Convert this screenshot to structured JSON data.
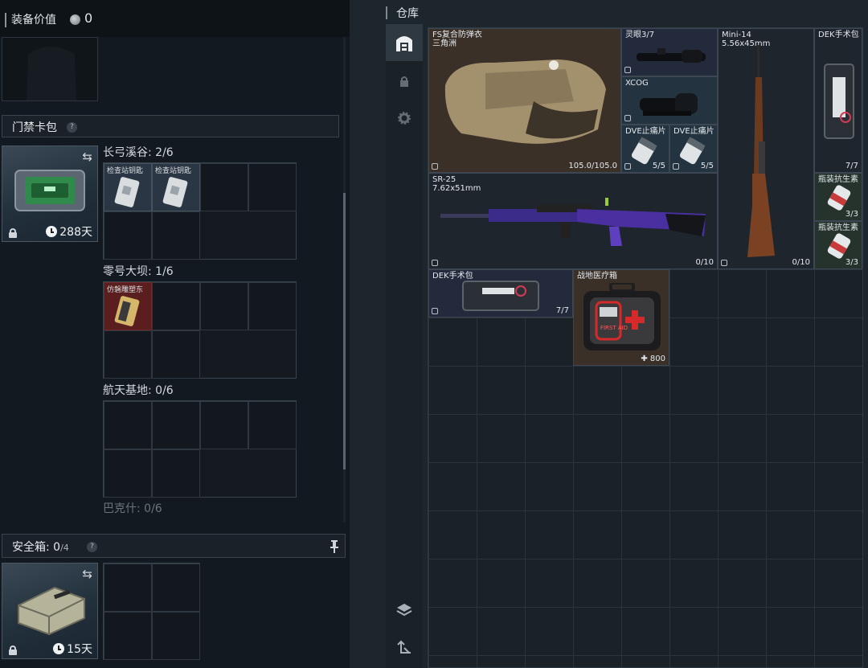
{
  "left": {
    "equipment_value_label": "装备价值",
    "equipment_value": "0",
    "access_card": {
      "title": "门禁卡包",
      "help": "?",
      "timer": "288天",
      "zones": [
        {
          "label": "长弓溪谷: 2/6",
          "items": [
            "检查站钥匙",
            "检查站钥匙"
          ]
        },
        {
          "label": "零号大坝: 1/6",
          "items": [
            "仿磐雕塑东"
          ]
        },
        {
          "label": "航天基地: 0/6",
          "items": []
        },
        {
          "label": "巴克什: 0/6",
          "items": []
        }
      ]
    },
    "safe_box": {
      "title": "安全箱: ",
      "count": "0",
      "capacity": "/4",
      "help": "?",
      "timer": "15天"
    }
  },
  "right": {
    "title": "仓库",
    "items": [
      {
        "name": "FS复合防弹衣",
        "sub": "三角洲",
        "count": "105.0/105.0",
        "icon": "body-armor"
      },
      {
        "name": "灵眼3/7",
        "icon": "rifle-scope"
      },
      {
        "name": "XCOG",
        "icon": "acog-scope"
      },
      {
        "name": "DVE止痛片",
        "count": "5/5",
        "icon": "pill-bottle"
      },
      {
        "name": "DVE止痛片",
        "count": "5/5",
        "icon": "pill-bottle"
      },
      {
        "name": "Mini-14",
        "sub": "5.56x45mm",
        "count": "0/10",
        "icon": "rifle"
      },
      {
        "name": "DEK手术包",
        "count": "7/7",
        "icon": "surgery-kit"
      },
      {
        "name": "SR-25",
        "sub": "7.62x51mm",
        "count": "0/10",
        "icon": "sniper-rifle"
      },
      {
        "name": "瓶装抗生素",
        "count": "3/3",
        "icon": "antibiotic-bottle"
      },
      {
        "name": "瓶装抗生素",
        "count": "3/3",
        "icon": "antibiotic-bottle"
      },
      {
        "name": "DEK手术包",
        "count": "7/7",
        "icon": "surgery-kit"
      },
      {
        "name": "战地医疗箱",
        "count": "800",
        "icon": "first-aid-kit",
        "prefix": "✚"
      }
    ],
    "first_aid_text": "FIRST AID",
    "tabs": [
      "warehouse-icon",
      "lock-icon",
      "gear-icon",
      "layers-icon",
      "sort-icon"
    ]
  }
}
